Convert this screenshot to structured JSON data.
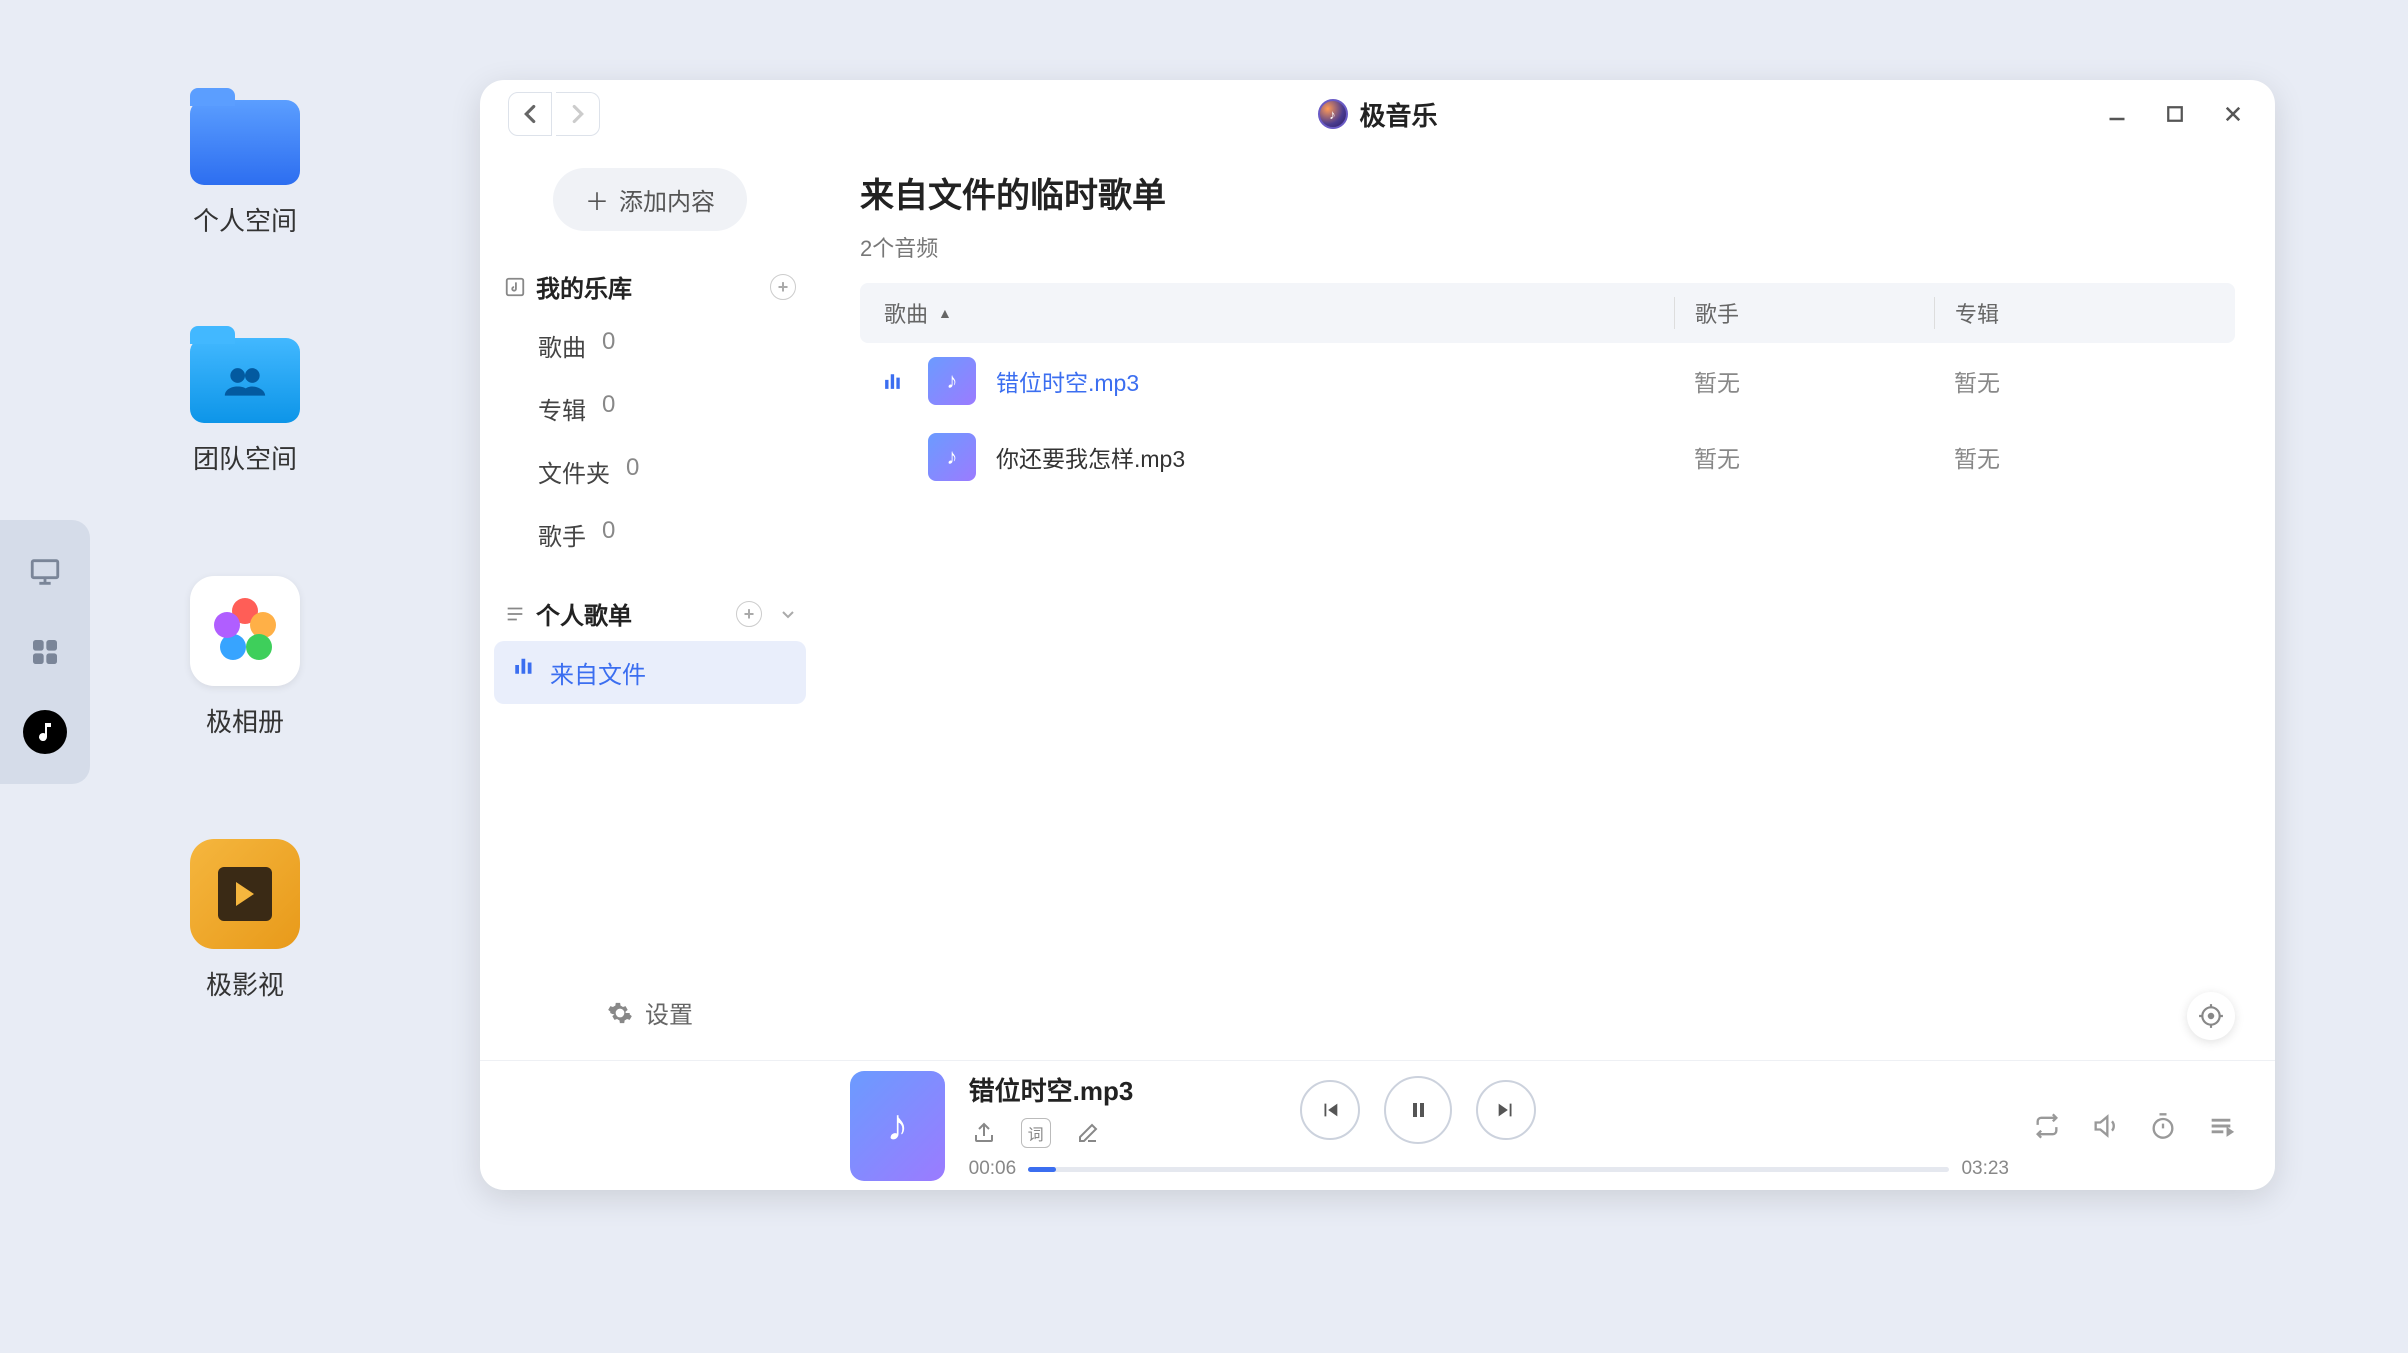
{
  "desktop": {
    "icons": [
      {
        "label": "个人空间"
      },
      {
        "label": "团队空间"
      },
      {
        "label": "极相册"
      },
      {
        "label": "极影视"
      }
    ]
  },
  "window": {
    "title": "极音乐"
  },
  "sidebar": {
    "add_content": "添加内容",
    "library_section": "我的乐库",
    "library_items": [
      {
        "label": "歌曲",
        "count": "0"
      },
      {
        "label": "专辑",
        "count": "0"
      },
      {
        "label": "文件夹",
        "count": "0"
      },
      {
        "label": "歌手",
        "count": "0"
      }
    ],
    "playlist_section": "个人歌单",
    "playlist_items": [
      {
        "label": "来自文件"
      }
    ],
    "settings": "设置"
  },
  "content": {
    "title": "来自文件的临时歌单",
    "subtitle": "2个音频",
    "columns": {
      "song": "歌曲",
      "artist": "歌手",
      "album": "专辑"
    },
    "tracks": [
      {
        "name": "错位时空.mp3",
        "artist": "暂无",
        "album": "暂无",
        "playing": true
      },
      {
        "name": "你还要我怎样.mp3",
        "artist": "暂无",
        "album": "暂无",
        "playing": false
      }
    ]
  },
  "player": {
    "now_title": "错位时空.mp3",
    "elapsed": "00:06",
    "total": "03:23",
    "lyrics_label": "词"
  }
}
